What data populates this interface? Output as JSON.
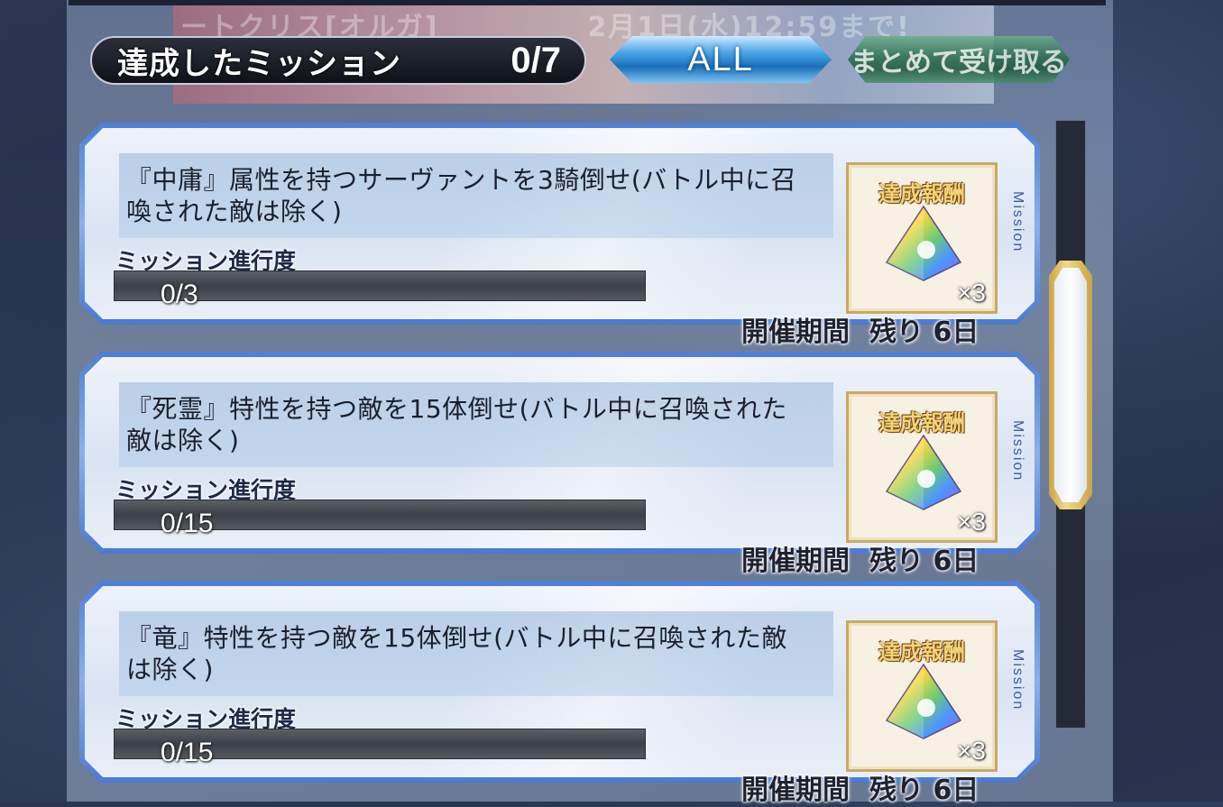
{
  "header": {
    "title": "達成したミッション",
    "count": "0/7"
  },
  "filter_button": {
    "label": "ALL"
  },
  "receive_all_button": {
    "label": "まとめて受け取る"
  },
  "background": {
    "banner_text": "ートクリス[オルガ]",
    "banner_date": "2月1日(水)12:59まで!"
  },
  "missions": [
    {
      "text": "『中庸』属性を持つサーヴァントを3騎倒せ(バトル中に召喚された敵は除く)",
      "progress_label": "ミッション進行度",
      "progress_value": "0/3",
      "progress_fraction": 0,
      "reward_label": "達成報酬",
      "reward_icon": "saint-quartz-icon",
      "reward_qty": "×3",
      "side_tab": "Mission",
      "period_label": "開催期間",
      "period_remaining": "残り 6日"
    },
    {
      "text": "『死霊』特性を持つ敵を15体倒せ(バトル中に召喚された敵は除く)",
      "progress_label": "ミッション進行度",
      "progress_value": "0/15",
      "progress_fraction": 0,
      "reward_label": "達成報酬",
      "reward_icon": "saint-quartz-icon",
      "reward_qty": "×3",
      "side_tab": "Mission",
      "period_label": "開催期間",
      "period_remaining": "残り 6日"
    },
    {
      "text": "『竜』特性を持つ敵を15体倒せ(バトル中に召喚された敵は除く)",
      "progress_label": "ミッション進行度",
      "progress_value": "0/15",
      "progress_fraction": 0,
      "reward_label": "達成報酬",
      "reward_icon": "saint-quartz-icon",
      "reward_qty": "×3",
      "side_tab": "Mission",
      "period_label": "開催期間",
      "period_remaining": "残り 6日"
    }
  ]
}
